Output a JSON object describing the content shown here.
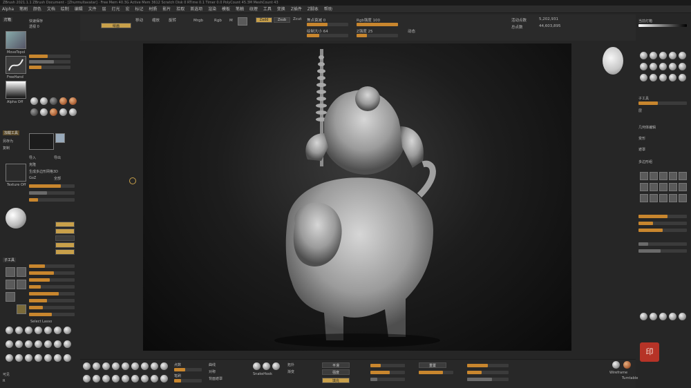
{
  "titlebar": {
    "text": "ZBrush 2021.1.1 ZBrush Document - [Zhurmultavatar] · Free Mem 40.3G  Active Mem 3612  Scratch Disk 0  RTime 0.1  Timer 0.0  PolyCount 45.3M  MeshCount 43"
  },
  "menu": [
    "Alpha",
    "笔刷",
    "颜色",
    "文档",
    "绘制",
    "编辑",
    "文件",
    "层",
    "灯光",
    "宏",
    "标记",
    "材质",
    "影片",
    "拾取",
    "首选项",
    "渲染",
    "模板",
    "笔触",
    "纹理",
    "工具",
    "变换",
    "Z插件",
    "Z脚本",
    "帮助"
  ],
  "topshelf": {
    "cells": [
      "投射",
      "绘画",
      "编辑",
      "移动",
      "缩放",
      "旋转",
      "Mrgb",
      "Rgb",
      "M",
      "Zadd",
      "Zsub",
      "Zcut",
      "焦点衰减",
      "强度",
      "Z强度",
      "绘制大小",
      "动态",
      "活动点数",
      "总点数"
    ],
    "active_points": "5,202,931",
    "total_points": "44,603,895",
    "focal_label": "焦点衰减 0",
    "intensity_label": "Rgb强度 100",
    "z_intensity_label": "Z强度 25",
    "draw_size_label": "绘制大小 64",
    "dynamic_label": "动态"
  },
  "leftpanel": {
    "header": "灯箱",
    "quick_save": "快速保存",
    "see_through": "透视 0",
    "brush_label": "MoveTopol",
    "stroke_label": "FreeHand",
    "alpha_label": "Alpha Off",
    "texture_label": "Texture Off",
    "material_label": "Mat",
    "menus": [
      "加载工具",
      "另存为",
      "复制",
      "导入",
      "导出",
      "克隆",
      "生成多边形网格3D",
      "GoZ",
      "全部",
      "可见",
      "R"
    ],
    "subtool_label": "子工具",
    "items": [
      "Select Lasso",
      "SelectRect",
      "ClipCurve",
      "TrimCurve",
      "SliceCurve",
      "SculptrisPro",
      "Standard",
      "Move",
      "hPolish",
      "ClayBuildup",
      "DamStandard",
      "Inflat",
      "Pinch",
      "Smooth",
      "Layer",
      "TrimDynamic",
      "Planar",
      "Nudge"
    ],
    "swatch_label": "Switch"
  },
  "rightpanel": {
    "header": "当前灯箱",
    "subtool": "子工具",
    "layers": "层",
    "geometry": "几何体编辑",
    "deformation": "变形",
    "masking": "遮罩",
    "polygroups": "多边形组",
    "brushes": [
      "Smooth",
      "Standard",
      "MoveT",
      "ClayBuild",
      "DamStd",
      "Inflate",
      "Pinch",
      "Move",
      "hPolish",
      "TrimDyn",
      "Planar",
      "Nudge",
      "Layer",
      "Blob",
      "Flatten",
      "Magnify",
      "SnakeHook",
      "Curve",
      "IMM",
      "ZModeler"
    ],
    "stamp_text": "印"
  },
  "bottombar": {
    "items": [
      "SnakeHook",
      "ClipCurve",
      "hPolish",
      "Standard",
      "DamStd",
      "Move",
      "Inflate",
      "Pinch",
      "Smooth",
      "Layer"
    ],
    "labels": [
      "点数",
      "笔刷",
      "曲线",
      "对称",
      "背面遮罩",
      "拓扑",
      "渐变",
      "平滑",
      "强度",
      "填充",
      "重置"
    ]
  },
  "corner": {
    "label": "Wireframe",
    "label2": "Turntable"
  }
}
